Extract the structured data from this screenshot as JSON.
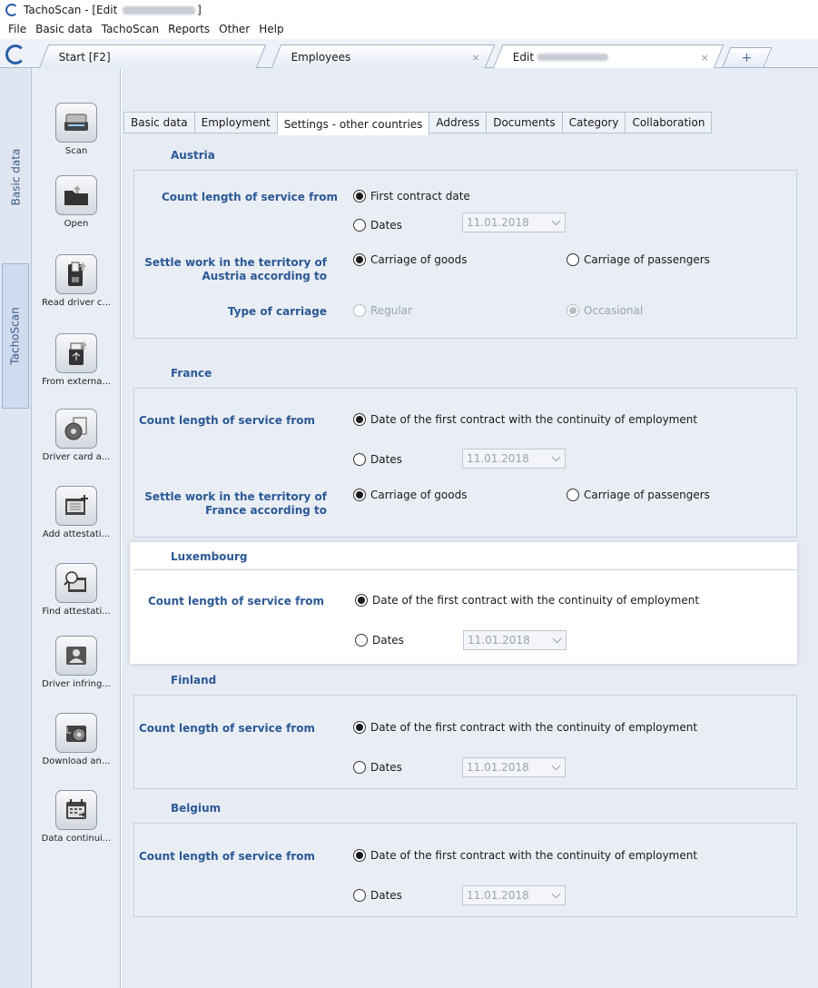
{
  "window": {
    "title_prefix": "TachoScan - [Edit",
    "title_suffix": "]"
  },
  "menu": [
    "File",
    "Basic data",
    "TachoScan",
    "Reports",
    "Other",
    "Help"
  ],
  "doc_tabs": {
    "start": "Start [F2]",
    "employees": "Employees",
    "edit": "Edit",
    "close": "×",
    "add": "+"
  },
  "vertical_tabs": {
    "basic_data": "Basic data",
    "tachoscan": "TachoScan"
  },
  "tools": [
    {
      "label": "Scan",
      "icon": "scanner-icon"
    },
    {
      "label": "Open",
      "icon": "folder-icon"
    },
    {
      "label": "Read driver c...",
      "icon": "card-reader-icon"
    },
    {
      "label": "From externa...",
      "icon": "usb-icon"
    },
    {
      "label": "Driver card a...",
      "icon": "disc-icon"
    },
    {
      "label": "Add attestati...",
      "icon": "add-document-icon"
    },
    {
      "label": "Find attestati...",
      "icon": "search-document-icon"
    },
    {
      "label": "Driver infring...",
      "icon": "driver-icon"
    },
    {
      "label": "Download an...",
      "icon": "download-icon"
    },
    {
      "label": "Data continui...",
      "icon": "calendar-icon"
    }
  ],
  "inner_tabs": [
    "Basic data",
    "Employment",
    "Settings - other countries",
    "Address",
    "Documents",
    "Category",
    "Collaboration"
  ],
  "austria": {
    "title": "Austria",
    "count_label": "Count length of service from",
    "opt_first": "First contract date",
    "opt_dates": "Dates",
    "date": "11.01.2018",
    "settle_label_1": "Settle work in the territory of",
    "settle_label_2": "Austria according to",
    "goods": "Carriage of goods",
    "passengers": "Carriage of passengers",
    "type_label": "Type of carriage",
    "regular": "Regular",
    "occasional": "Occasional"
  },
  "france": {
    "title": "France",
    "count_label": "Count length of service from",
    "opt_first": "Date of the first contract with the continuity of employment",
    "opt_dates": "Dates",
    "date": "11.01.2018",
    "settle_label_1": "Settle work in the territory of",
    "settle_label_2": "France according to",
    "goods": "Carriage of goods",
    "passengers": "Carriage of passengers"
  },
  "luxembourg": {
    "title": "Luxembourg",
    "count_label": "Count length of service from",
    "opt_first": "Date of the first contract with the continuity of employment",
    "opt_dates": "Dates",
    "date": "11.01.2018"
  },
  "finland": {
    "title": "Finland",
    "count_label": "Count length of service from",
    "opt_first": "Date of the first contract with the continuity of employment",
    "opt_dates": "Dates",
    "date": "11.01.2018"
  },
  "belgium": {
    "title": "Belgium",
    "count_label": "Count length of service from",
    "opt_first": "Date of the first contract with the continuity of employment",
    "opt_dates": "Dates",
    "date": "11.01.2018"
  },
  "colors": {
    "label_blue": "#2c5895",
    "panel_bg": "#e9eef5",
    "highlight_bg": "#ffffff"
  }
}
